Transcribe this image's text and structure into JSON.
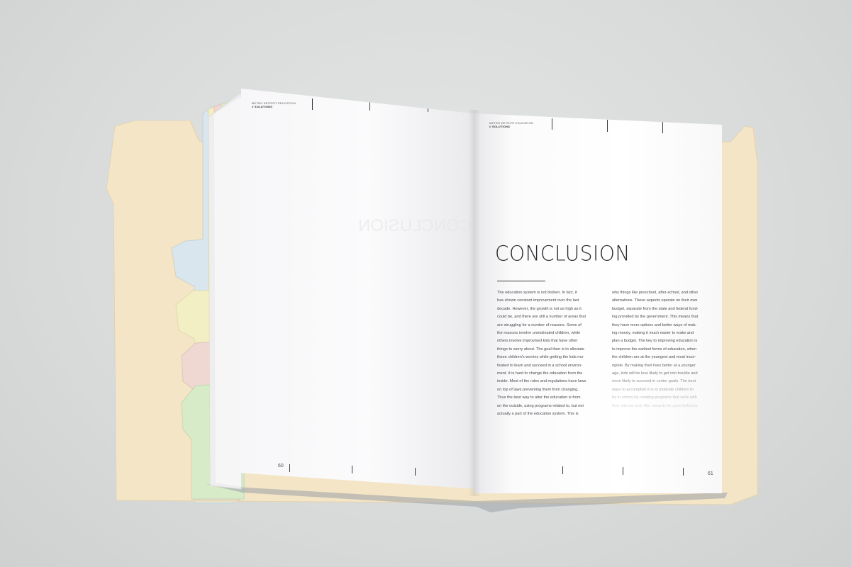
{
  "left_page": {
    "header": "METRO DETROIT EDUCATION",
    "subheader": "// SOLUTIONS",
    "page_number": "60"
  },
  "right_page": {
    "header": "METRO DETROIT EDUCATION",
    "subheader": "// SOLUTIONS",
    "title": "CONCLUSION",
    "page_number": "61",
    "column_1": "The education system is not broken. In fact, it\nhas shown constant improvement over the last\ndecade. However, the growth is not as high as it\ncould be, and there are still a number of areas that\nare struggling for a number of reasons. Some of\nthe reasons involve unmotivated children, while\nothers involve improvised kids that have other\nthings to worry about. The goal then is to alleviate\nthese children's worries while getting the kids mo-\ntivated to learn and succeed in a school environ-\nment.  It is hard to change the education from the\ninside. Most of the rules and regulations have laws\non top of laws preventing them from changing.\nThus the best way to alter the education is from\non the outside, using programs related to, but not\nactually a part of the education system. This is",
    "column_2": "why things like preschool, after-school, and other\nalternatives. These aspects operate on their own\nbudget, separate from the state and federal fund-\ning provided by the government. This means that\nthey have more options and better ways of mak-\ning money, making it much easier to make and\nplan a budget. The key to improving education is\nto improve the earliest forms of education, when\nthe children are at the youngest and most incor-\nrigible.  By making their lives better at a younger\nage, kids will be less likely to get into trouble and\nmore likely to succeed in center goals. The best\nways to accomplish it is to motivate children to\ntry in school by creating programs that work with\ntheir interest and offer rewards for good behavior."
  },
  "colors": {
    "folder": "#f3e5c6",
    "tab_blue": "#d9e6ee",
    "tab_yellow": "#f2efc4",
    "tab_pink": "#f0d8d2",
    "tab_green": "#d8ebc9",
    "ink": "#2a2a2e"
  }
}
